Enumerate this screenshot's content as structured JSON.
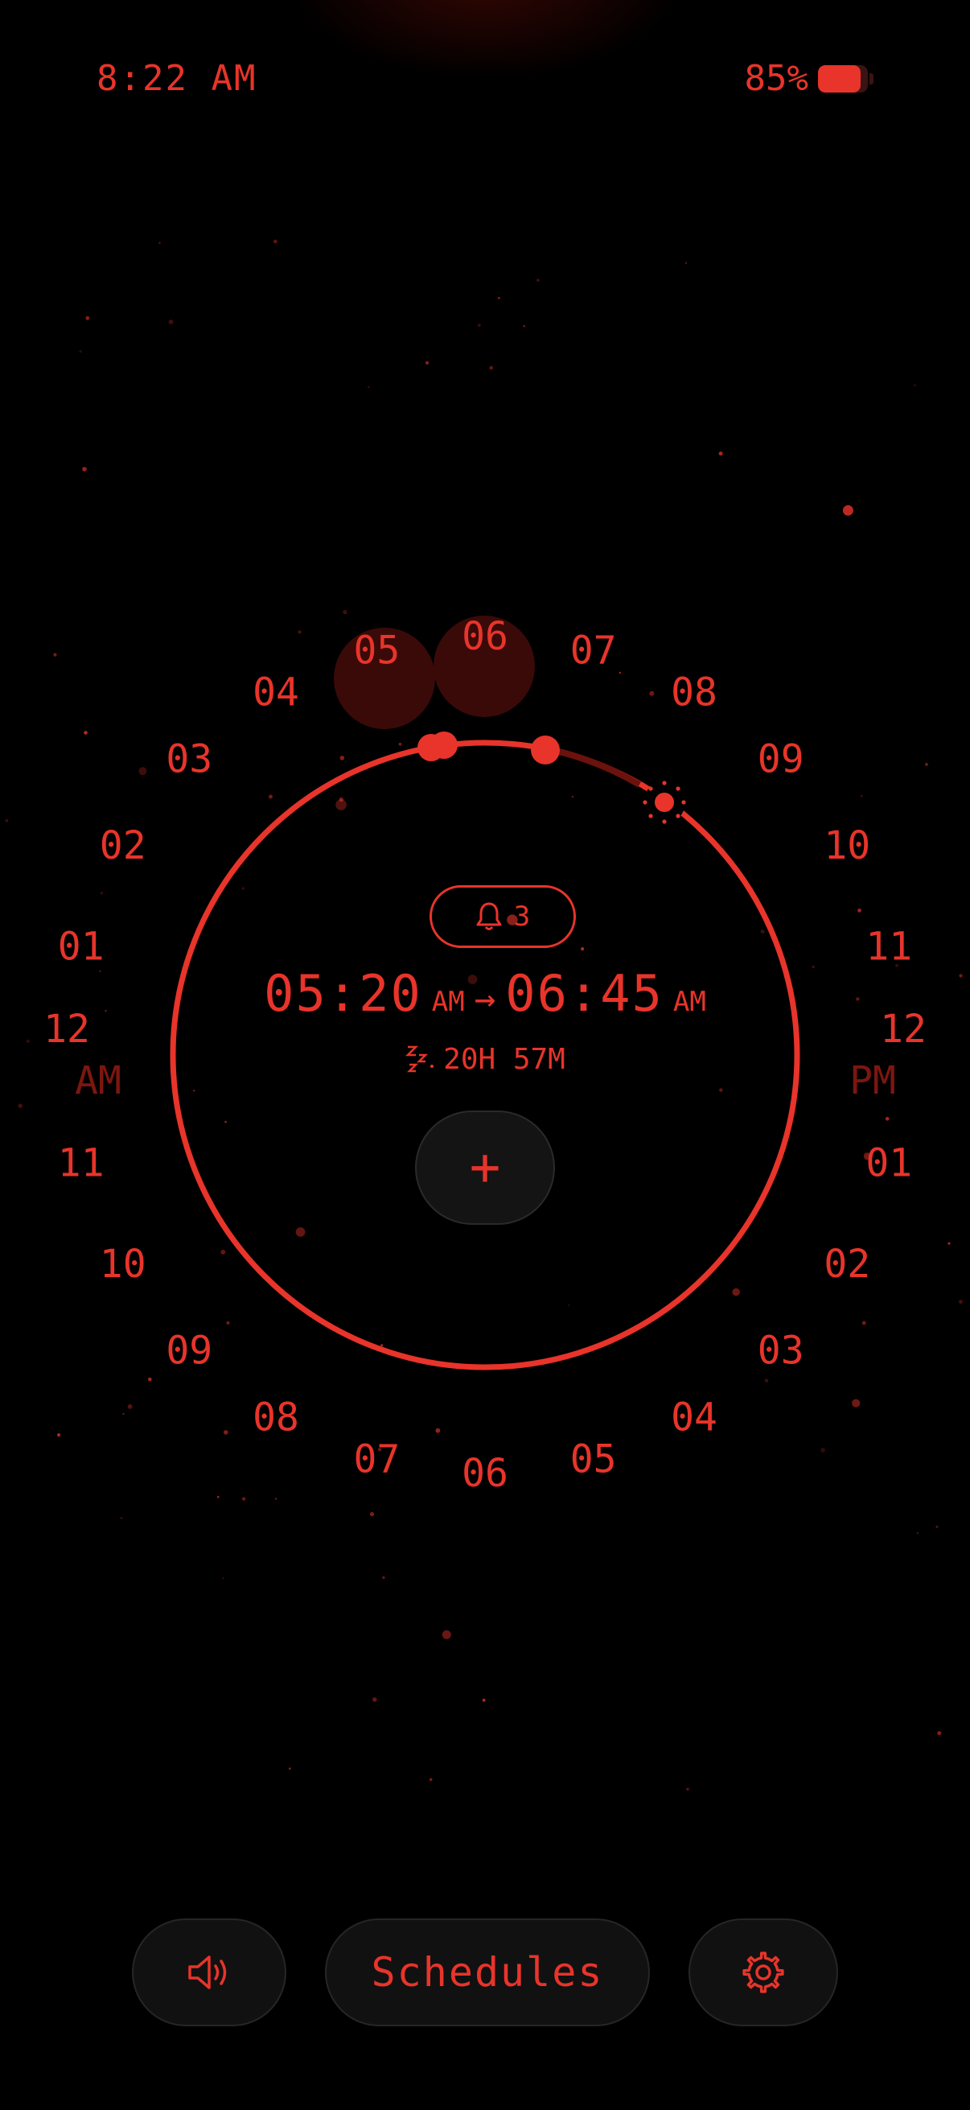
{
  "status_bar": {
    "time": "8:22 AM",
    "battery_percent": "85%",
    "battery_level": 0.85
  },
  "dial": {
    "am_hours": [
      "12",
      "01",
      "02",
      "03",
      "04",
      "05",
      "06",
      "07",
      "08",
      "09",
      "10",
      "11"
    ],
    "pm_hours": [
      "12",
      "01",
      "02",
      "03",
      "04",
      "05",
      "06",
      "07",
      "08",
      "09",
      "10",
      "11"
    ],
    "am_label": "AM",
    "pm_label": "PM",
    "highlighted_hours": [
      "05",
      "06"
    ]
  },
  "alarm": {
    "bell_icon": "bell-icon",
    "count": "3",
    "start_time": "05:20",
    "start_meridiem": "AM",
    "arrow": "→",
    "end_time": "06:45",
    "end_meridiem": "AM",
    "sleep_icon": "zzz-icon",
    "duration": "20H 57M"
  },
  "add_button": {
    "label": "+"
  },
  "bottom_bar": {
    "sound_icon": "speaker-icon",
    "schedules_label": "Schedules",
    "settings_icon": "gear-icon"
  },
  "colors": {
    "accent": "#e8342a",
    "dim_accent": "#7d1610",
    "background": "#000000"
  }
}
